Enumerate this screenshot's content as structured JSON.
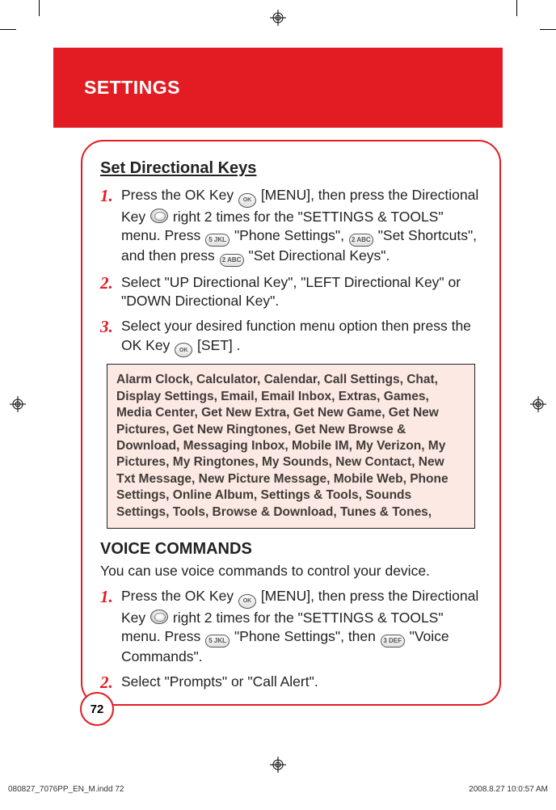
{
  "header": {
    "title": "SETTINGS"
  },
  "section1": {
    "title": "Set Directional Keys",
    "step1_a": "Press the OK Key ",
    "step1_b": " [MENU], then press the Directional Key ",
    "step1_c": " right 2 times for the \"SETTINGS & TOOLS\" menu. Press ",
    "step1_d": " \"Phone Settings\", ",
    "step1_e": " \"Set Shortcuts\", and then press ",
    "step1_f": " \"Set Directional Keys\".",
    "step2": "Select \"UP Directional Key\", \"LEFT Directional Key\" or \"DOWN Directional Key\".",
    "step3_a": "Select your desired function menu option then press the OK Key ",
    "step3_b": " [SET] .",
    "callout": "Alarm Clock, Calculator, Calendar, Call Settings, Chat, Display Settings, Email, Email Inbox, Extras, Games, Media Center, Get New Extra, Get New Game, Get New Pictures, Get New Ringtones, Get New Browse & Download, Messaging Inbox, Mobile IM, My Verizon, My Pictures, My Ringtones, My Sounds, New Contact, New Txt Message, New Picture Message, Mobile Web, Phone Settings, Online Album, Settings & Tools, Sounds Settings, Tools, Browse & Download, Tunes & Tones,"
  },
  "section2": {
    "title": "VOICE COMMANDS",
    "intro": "You can use voice commands to control your device.",
    "step1_a": "Press the OK Key ",
    "step1_b": " [MENU], then press the Directional Key ",
    "step1_c": " right 2 times for the \"SETTINGS & TOOLS\" menu. Press ",
    "step1_d": " \"Phone Settings\", then ",
    "step1_e": " \"Voice Commands\".",
    "step2": "Select \"Prompts\" or \"Call Alert\"."
  },
  "keys": {
    "ok": "OK",
    "k5": "5 JKL",
    "k2": "2 ABC",
    "k3": "3 DEF"
  },
  "page_number": "72",
  "footer": {
    "left": "080827_7076PP_EN_M.indd   72",
    "right": "2008.8.27   10:0:57 AM"
  }
}
